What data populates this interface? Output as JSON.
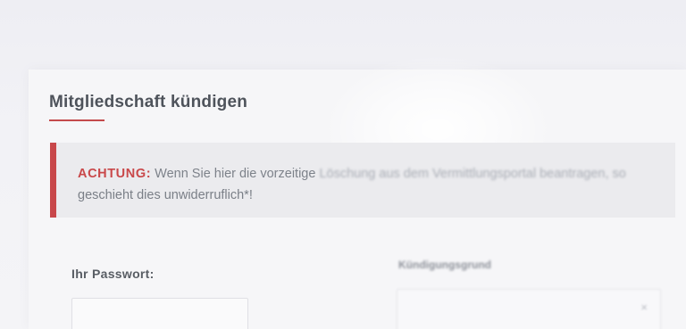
{
  "page": {
    "title": "Mitgliedschaft kündigen",
    "accent_color": "#c8474a"
  },
  "notice": {
    "label": "ACHTUNG:",
    "text_part1": "Wenn Sie hier die vorzeitige",
    "text_part2": "Löschung aus dem Vermittlungsportal beantragen, so",
    "text_line2": "geschieht dies unwiderruflich*!"
  },
  "form": {
    "password_label": "Ihr Passwort:",
    "password_value": "",
    "reason_label": "Kündigungsgrund",
    "reason_value": "",
    "reason_icon": "close-icon"
  }
}
